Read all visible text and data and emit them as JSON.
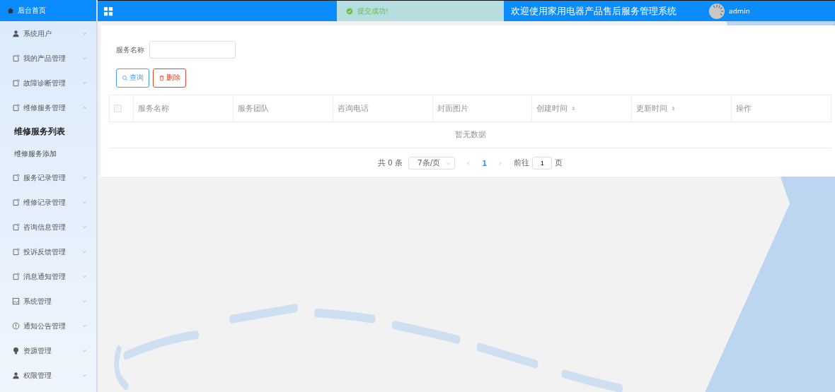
{
  "sidebar": {
    "home": {
      "label": "后台首页"
    },
    "items": [
      {
        "label": "系统用户",
        "kind": "person",
        "expanded": false
      },
      {
        "label": "我的产品管理",
        "kind": "doc",
        "expanded": false
      },
      {
        "label": "故障诊断管理",
        "kind": "doc",
        "expanded": false
      },
      {
        "label": "维修服务管理",
        "kind": "doc",
        "expanded": true,
        "children": [
          {
            "label": "维修服务列表",
            "selected": true
          },
          {
            "label": "维修服务添加",
            "selected": false
          }
        ]
      },
      {
        "label": "服务记录管理",
        "kind": "doc",
        "expanded": false
      },
      {
        "label": "维修记录管理",
        "kind": "doc",
        "expanded": false
      },
      {
        "label": "咨询信息管理",
        "kind": "doc",
        "expanded": false
      },
      {
        "label": "投诉反馈管理",
        "kind": "doc",
        "expanded": false
      },
      {
        "label": "消息通知管理",
        "kind": "doc",
        "expanded": false
      },
      {
        "label": "系统管理",
        "kind": "image",
        "expanded": false
      },
      {
        "label": "通知公告管理",
        "kind": "info",
        "expanded": false
      },
      {
        "label": "资源管理",
        "kind": "bulb",
        "expanded": false
      },
      {
        "label": "权限管理",
        "kind": "person",
        "expanded": false
      }
    ]
  },
  "topbar": {
    "title": "欢迎使用家用电器产品售后服务管理系统",
    "user": "admin"
  },
  "toast": {
    "kind": "success",
    "text": "提交成功!"
  },
  "search": {
    "label": "服务名称"
  },
  "buttons": [
    {
      "label": "查询",
      "kind": "query"
    },
    {
      "label": "删除",
      "kind": "delete"
    }
  ],
  "table": {
    "select_all": {
      "checked": false
    },
    "columns": [
      {
        "label": "服务名称",
        "sortable": false
      },
      {
        "label": "服务团队",
        "sortable": false
      },
      {
        "label": "咨询电话",
        "sortable": false
      },
      {
        "label": "封面图片",
        "sortable": false
      },
      {
        "label": "创建时间",
        "sortable": true
      },
      {
        "label": "更新时间",
        "sortable": true
      },
      {
        "label": "操作",
        "sortable": false
      }
    ],
    "empty_text": "暂无数据"
  },
  "pagination": {
    "total": "共 0 条",
    "page_size": "7条/页",
    "pages": [
      {
        "label": "1",
        "selected": true
      }
    ],
    "goto_label": "前往",
    "goto_value": "1",
    "goto_suffix": "页"
  }
}
